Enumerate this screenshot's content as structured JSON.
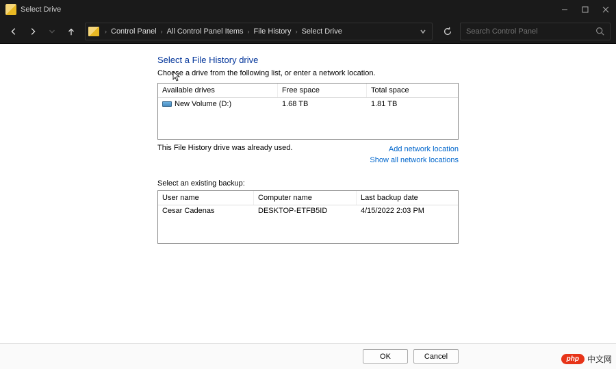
{
  "titlebar": {
    "title": "Select Drive"
  },
  "breadcrumbs": [
    "Control Panel",
    "All Control Panel Items",
    "File History",
    "Select Drive"
  ],
  "search": {
    "placeholder": "Search Control Panel"
  },
  "page": {
    "title": "Select a File History drive",
    "desc": "Choose a drive from the following list, or enter a network location.",
    "status": "This File History drive was already used.",
    "link_add": "Add network location",
    "link_show": "Show all network locations",
    "backup_label": "Select an existing backup:"
  },
  "drive_headers": {
    "drives": "Available drives",
    "free": "Free space",
    "total": "Total space"
  },
  "drives": [
    {
      "name": "New Volume (D:)",
      "free": "1.68 TB",
      "total": "1.81 TB"
    }
  ],
  "backup_headers": {
    "user": "User name",
    "comp": "Computer name",
    "date": "Last backup date"
  },
  "backups": [
    {
      "user": "Cesar Cadenas",
      "comp": "DESKTOP-ETFB5ID",
      "date": "4/15/2022 2:03 PM"
    }
  ],
  "buttons": {
    "ok": "OK",
    "cancel": "Cancel"
  },
  "watermark": {
    "badge": "php",
    "text": "中文网"
  }
}
